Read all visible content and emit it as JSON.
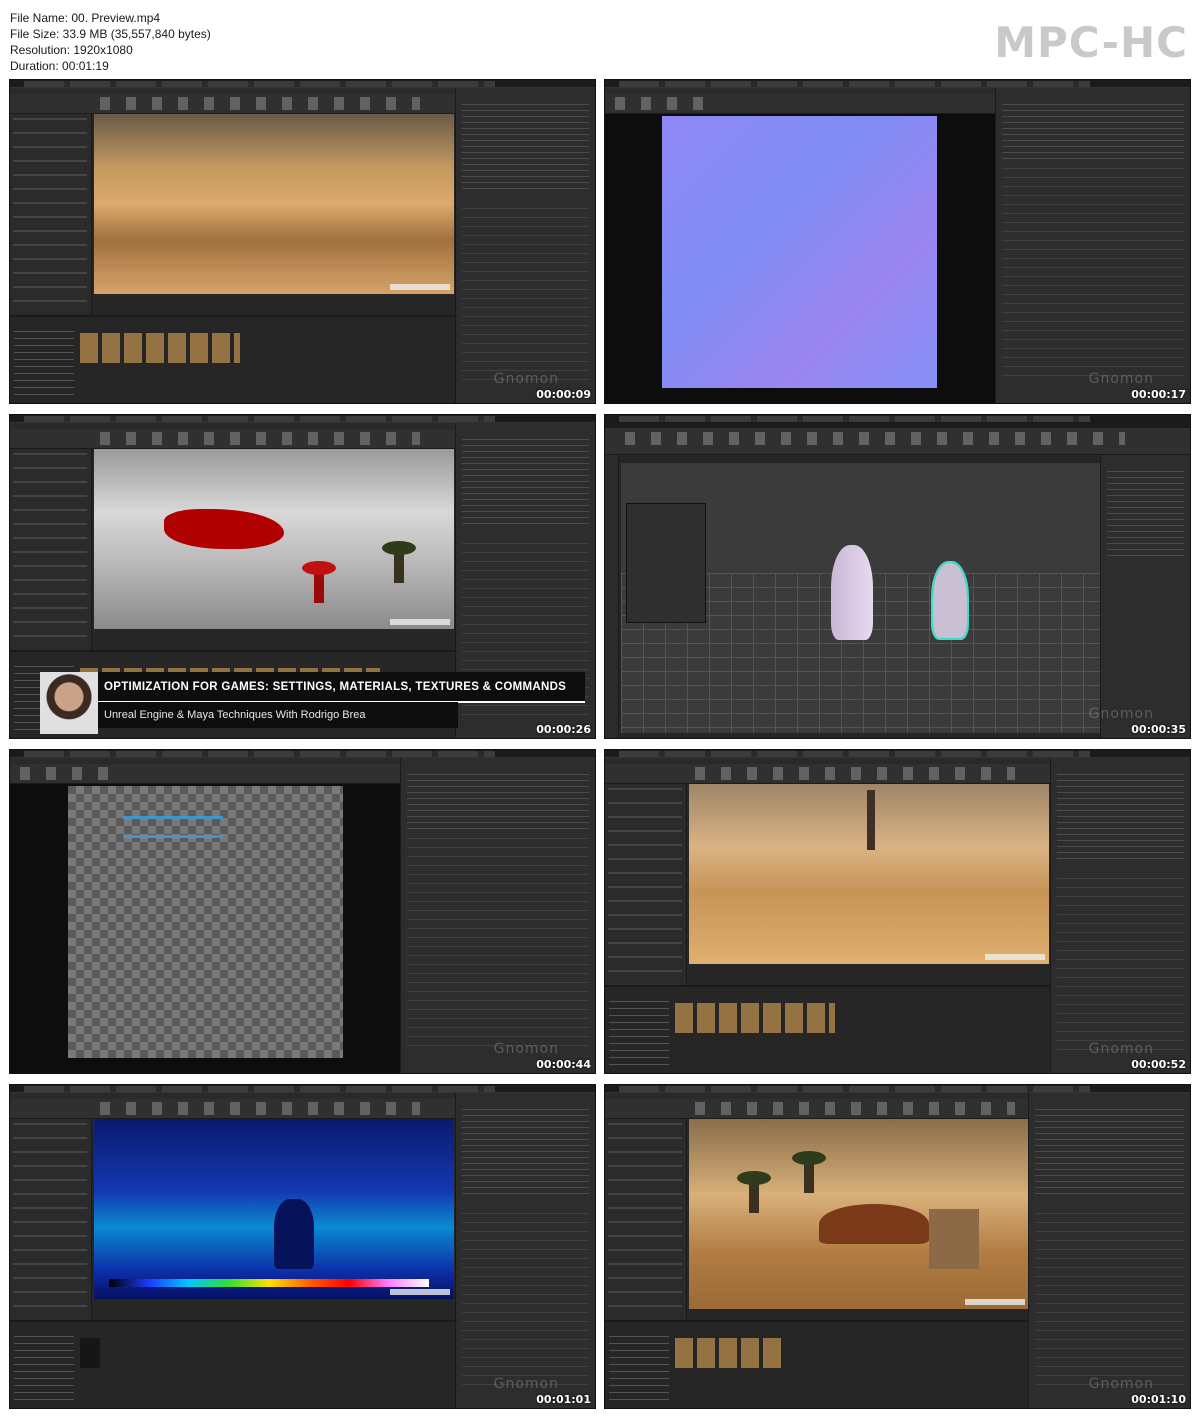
{
  "file_info": {
    "file_name": "File Name: 00. Preview.mp4",
    "file_size": "File Size: 33.9 MB (35,557,840 bytes)",
    "resolution": "Resolution: 1920x1080",
    "duration": "Duration: 00:01:19"
  },
  "player_brand": "MPC-HC",
  "watermark": "Gnomon",
  "banner": {
    "title": "OPTIMIZATION FOR GAMES: SETTINGS, MATERIALS, TEXTURES & COMMANDS",
    "subtitle": "Unreal Engine & Maya Techniques With Rodrigo Brea"
  },
  "thumbnails": [
    {
      "timestamp": "00:00:09",
      "scene": "desert-lit"
    },
    {
      "timestamp": "00:00:17",
      "scene": "normal-map-texture-editor"
    },
    {
      "timestamp": "00:00:26",
      "scene": "shader-complexity-gray"
    },
    {
      "timestamp": "00:00:35",
      "scene": "maya-viewport"
    },
    {
      "timestamp": "00:00:44",
      "scene": "alpha-texture-editor"
    },
    {
      "timestamp": "00:00:52",
      "scene": "desert-lit"
    },
    {
      "timestamp": "00:01:01",
      "scene": "quad-overdraw-view"
    },
    {
      "timestamp": "00:01:10",
      "scene": "desert-tent"
    }
  ],
  "colors": {
    "background": "#ffffff",
    "editor_dark": "#262626",
    "brand_text": "#c9c9c9"
  }
}
